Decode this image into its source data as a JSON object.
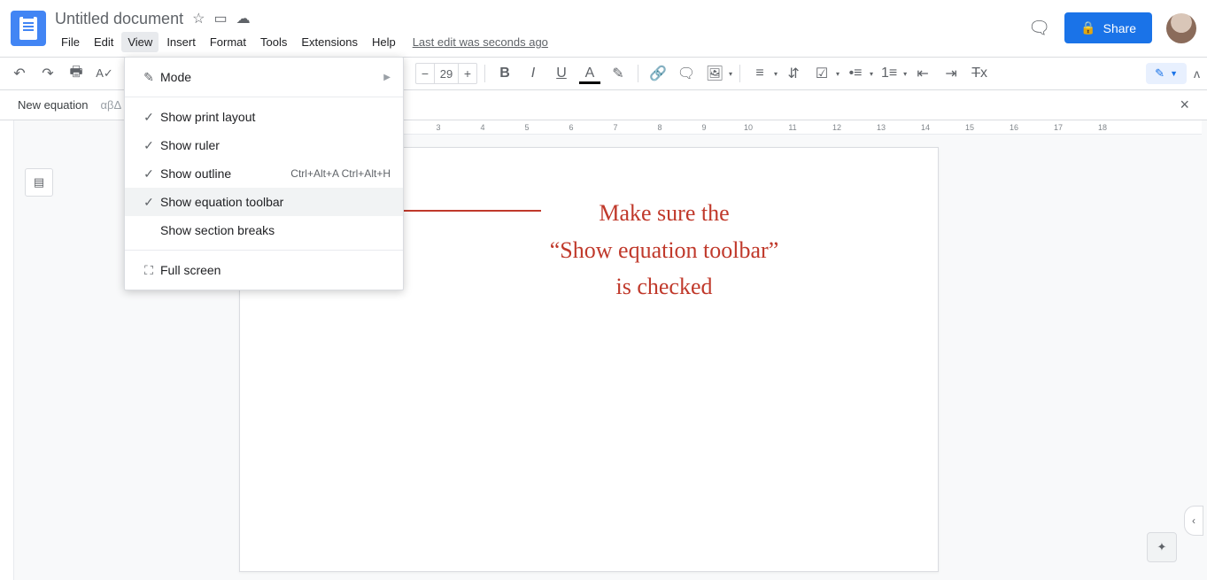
{
  "header": {
    "title": "Untitled document",
    "last_edit": "Last edit was seconds ago",
    "share_label": "Share"
  },
  "menus": [
    "File",
    "Edit",
    "View",
    "Insert",
    "Format",
    "Tools",
    "Extensions",
    "Help"
  ],
  "toolbar": {
    "font_size": "29"
  },
  "eq_bar": {
    "label": "New equation",
    "greek": "αβΔ"
  },
  "dropdown": {
    "mode": "Mode",
    "items": [
      {
        "icon": "check",
        "label": "Show print layout",
        "shortcut": ""
      },
      {
        "icon": "check",
        "label": "Show ruler",
        "shortcut": ""
      },
      {
        "icon": "check",
        "label": "Show outline",
        "shortcut": "Ctrl+Alt+A Ctrl+Alt+H"
      },
      {
        "icon": "check",
        "label": "Show equation toolbar",
        "shortcut": "",
        "hover": true
      },
      {
        "icon": "",
        "label": "Show section breaks",
        "shortcut": ""
      }
    ],
    "fullscreen": "Full screen"
  },
  "ruler_marks": [
    "3",
    "4",
    "5",
    "6",
    "7",
    "8",
    "9",
    "10",
    "11",
    "12",
    "13",
    "14",
    "15",
    "16",
    "17",
    "18"
  ],
  "annotation": {
    "line1": "Make sure the",
    "line2": "“Show equation toolbar”",
    "line3": "is checked"
  }
}
